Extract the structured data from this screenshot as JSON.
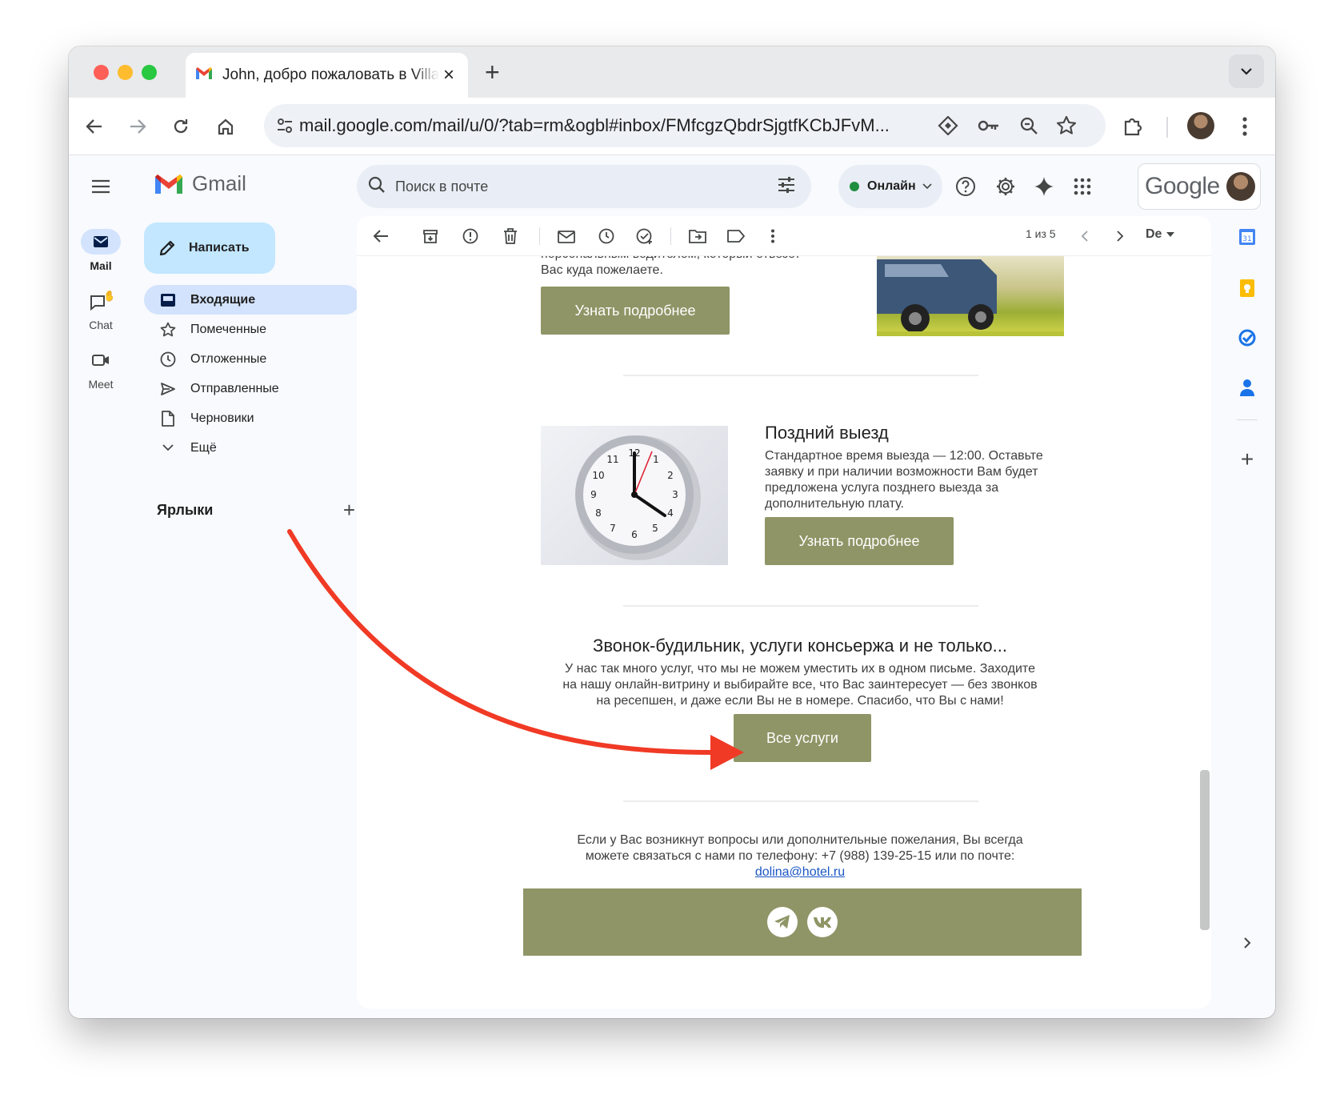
{
  "browser": {
    "tab_title": "John, добро пожаловать в Villa",
    "url": "mail.google.com/mail/u/0/?tab=rm&ogbl#inbox/FMfcgzQbdrSjgtfKCbJFvM..."
  },
  "gmail": {
    "logo_text": "Gmail",
    "rail": {
      "mail": "Mail",
      "chat": "Chat",
      "meet": "Meet"
    },
    "compose": "Написать",
    "nav": [
      {
        "label": "Входящие",
        "icon": "inbox-icon"
      },
      {
        "label": "Помеченные",
        "icon": "star-icon"
      },
      {
        "label": "Отложенные",
        "icon": "clock-icon"
      },
      {
        "label": "Отправленные",
        "icon": "send-icon"
      },
      {
        "label": "Черновики",
        "icon": "draft-icon"
      },
      {
        "label": "Ещё",
        "icon": "chevron-down-icon"
      }
    ],
    "labels_title": "Ярлыки",
    "search_placeholder": "Поиск в почте",
    "status": "Онлайн",
    "google_word": "Google",
    "pager": "1 из 5",
    "language": "De"
  },
  "email": {
    "top_text_partial": "персональным водителем, который отвезет",
    "top_text_line2": "Вас куда пожелаете.",
    "learn_more_1": "Узнать подробнее",
    "late_title": "Поздний выезд",
    "late_text": [
      "Стандартное время выезда — 12:00. Оставьте",
      "заявку и при наличии возможности Вам будет",
      "предложена услуга позднего выезда за",
      "дополнительную плату."
    ],
    "learn_more_2": "Узнать подробнее",
    "services_title": "Звонок-будильник, услуги консьержа и не только...",
    "services_text": [
      "У нас так много услуг, что мы не можем уместить их в одном письме. Заходите",
      "на нашу онлайн-витрину и выбирайте все, что Вас заинтересует — без звонков",
      "на ресепшен, и даже если Вы не в номере. Спасибо, что Вы с нами!"
    ],
    "all_services": "Все услуги",
    "contact_text": [
      "Если у Вас возникнут вопросы или дополнительные пожелания, Вы всегда",
      "можете связаться с нами по телефону: +7 (988) 139-25-15 или по почте:"
    ],
    "contact_email": "dolina@hotel.ru"
  },
  "colors": {
    "olive": "#8f9566",
    "arrow": "#f03a25",
    "active_nav": "#d3e3fd",
    "compose": "#c2e7ff"
  }
}
